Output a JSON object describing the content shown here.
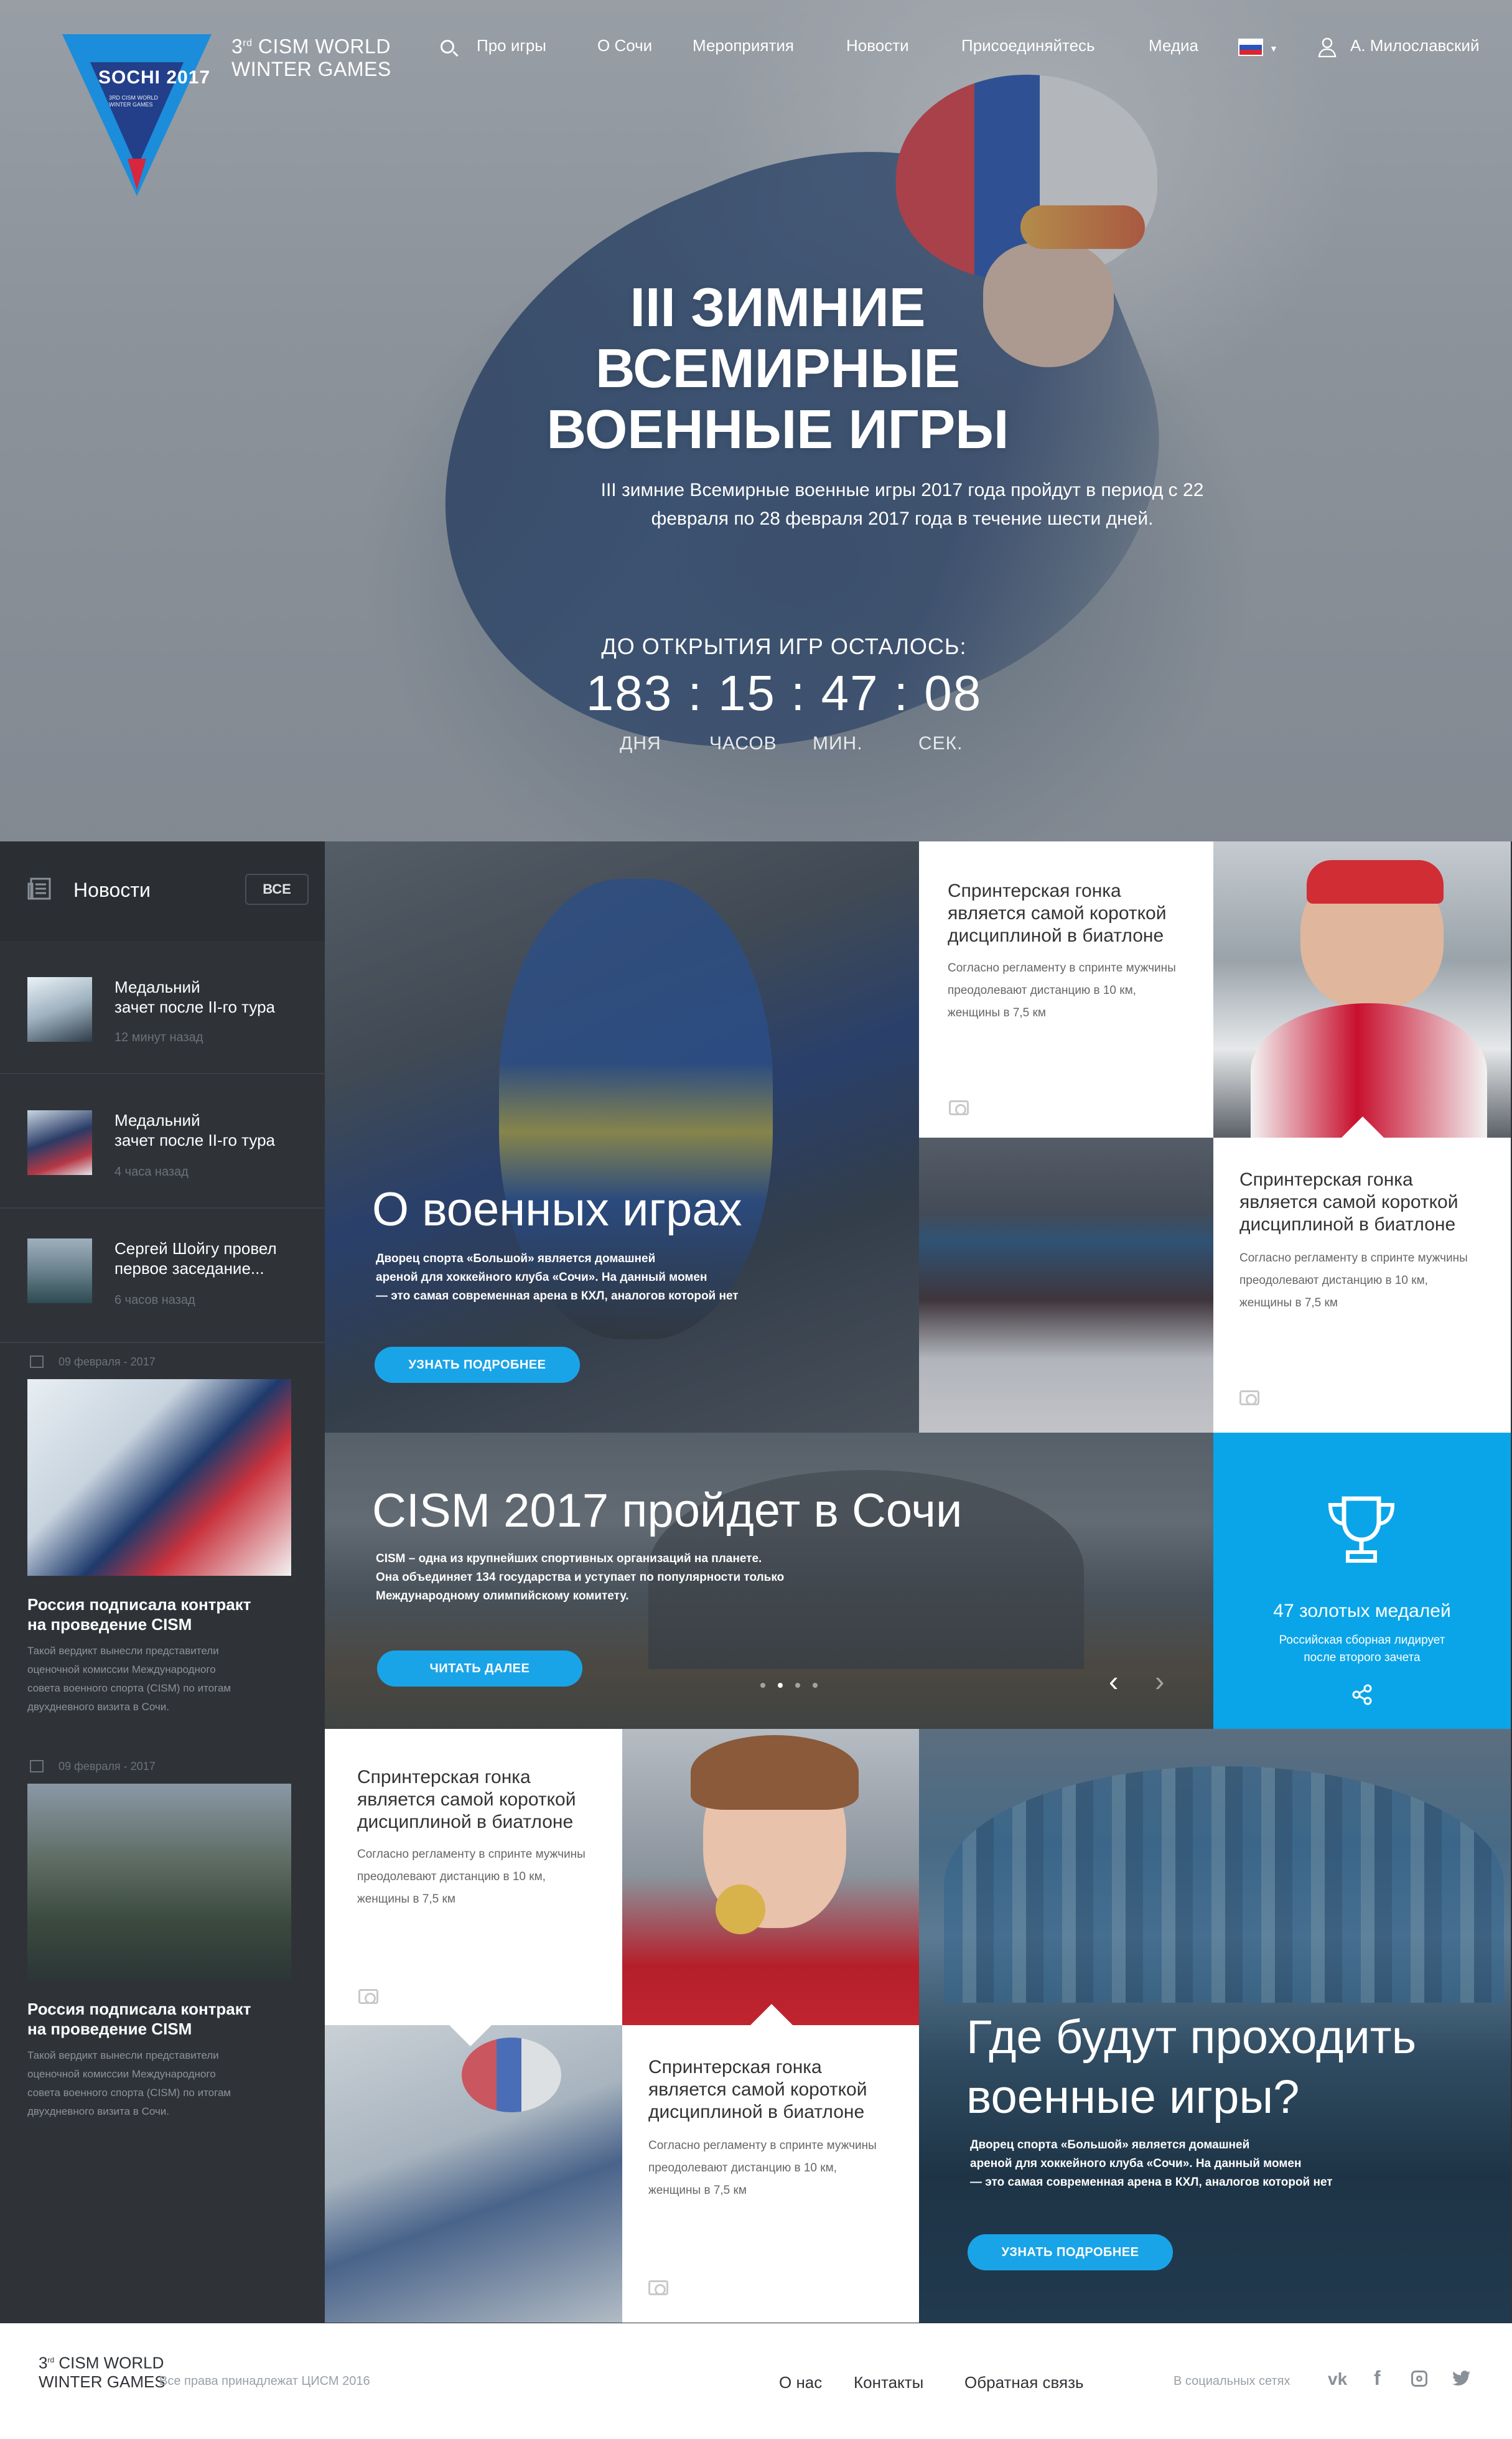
{
  "header": {
    "logo_text": "SOCHI 2017",
    "logo_sub": "3RD CISM WORLD WINTER GAMES",
    "brand_line1": "CISM WORLD",
    "brand_prefix": "3",
    "brand_sup": "rd",
    "brand_line2": "WINTER GAMES",
    "nav": [
      "Про игры",
      "О Сочи",
      "Мероприятия",
      "Новости",
      "Присоединяйтесь",
      "Медиа"
    ],
    "user_name": "А. Милославский"
  },
  "hero": {
    "title_lines": [
      "III ЗИМНИЕ",
      "ВСЕМИРНЫЕ",
      "ВОЕННЫЕ ИГРЫ"
    ],
    "lead_line1": "III зимние Всемирные военные игры 2017 года пройдут в период с 22",
    "lead_line2": "февраля по 28 февраля 2017 года в течение шести дней.",
    "countdown_caption": "ДО ОТКРЫТИЯ ИГР ОСТАЛОСЬ:",
    "countdown_value": "183 : 15 : 47 : 08",
    "units": [
      "ДНЯ",
      "ЧАСОВ",
      "МИН.",
      "СЕК."
    ]
  },
  "sidebar": {
    "title": "Новости",
    "all_label": "ВСЕ",
    "news": [
      {
        "title_l1": "Медальний",
        "title_l2": "зачет после II-го тура",
        "time": "12 минут назад"
      },
      {
        "title_l1": "Медальний",
        "title_l2": "зачет после II-го тура",
        "time": "4 часа назад"
      },
      {
        "title_l1": "Сергей Шойгу провел",
        "title_l2": "первое заседание...",
        "time": "6 часов назад"
      }
    ],
    "features": [
      {
        "date": "09 февраля - 2017",
        "title_l1": "Россия подписала контракт",
        "title_l2": "на проведение CISM",
        "text": [
          "Такой вердикт вынесли представители",
          "оценочной комиссии Международного",
          "совета военного спорта (CISM) по итогам",
          "двухдневного визита в Сочи."
        ]
      },
      {
        "date": "09 февраля - 2017",
        "title_l1": "Россия подписала контракт",
        "title_l2": "на проведение CISM",
        "text": [
          "Такой вердикт вынесли представители",
          "оценочной комиссии Международного",
          "совета военного спорта (CISM) по итогам",
          "двухдневного визита в Сочи."
        ]
      }
    ]
  },
  "about": {
    "title": "О военных играх",
    "text": [
      "Дворец спорта «Большой» является домашней",
      "ареной для хоккейного клуба «Сочи». На данный момен",
      "— это самая современная арена в КХЛ, аналогов которой нет"
    ],
    "button": "УЗНАТЬ ПОДРОБНЕЕ"
  },
  "cards": {
    "heading": [
      "Спринтерская гонка",
      "является самой короткой",
      "дисциплиной в биатлоне"
    ],
    "text": [
      "Согласно регламенту в спринте мужчины",
      "преодолевают дистанцию в 10 км,",
      "женщины в 7,5 км"
    ]
  },
  "cism": {
    "title": "CISM 2017 пройдет в Сочи",
    "text": [
      "CISM – одна из крупнейших спортивных организаций на планете.",
      "Она объединяет 134 государства и уступает по популярности только",
      "Международному олимпийскому комитету."
    ],
    "button": "ЧИТАТЬ ДАЛЕЕ",
    "slide_active": 1,
    "slide_count": 4
  },
  "medals": {
    "title": "47 золотых медалей",
    "text_l1": "Российская сборная лидирует",
    "text_l2": "после второго зачета"
  },
  "venue": {
    "title_l1": "Где будут проходить",
    "title_l2": "военные игры?",
    "text": [
      "Дворец спорта «Большой» является домашней",
      "ареной для хоккейного клуба «Сочи». На данный момен",
      "— это самая современная арена в КХЛ, аналогов которой нет"
    ],
    "button": "УЗНАТЬ ПОДРОБНЕЕ"
  },
  "footer": {
    "brand_prefix": "3",
    "brand_sup": "rd",
    "brand_line1": "CISM WORLD",
    "brand_line2": "WINTER GAMES",
    "copyright": "Все права принадлежат ЦИСМ 2016",
    "links": [
      "О нас",
      "Контакты",
      "Обратная связь"
    ],
    "social_label": "В социальных сетях"
  },
  "colors": {
    "accent": "#1aa4e8",
    "sidebar": "#2f3338",
    "medal_tile": "#0aa5e8"
  }
}
